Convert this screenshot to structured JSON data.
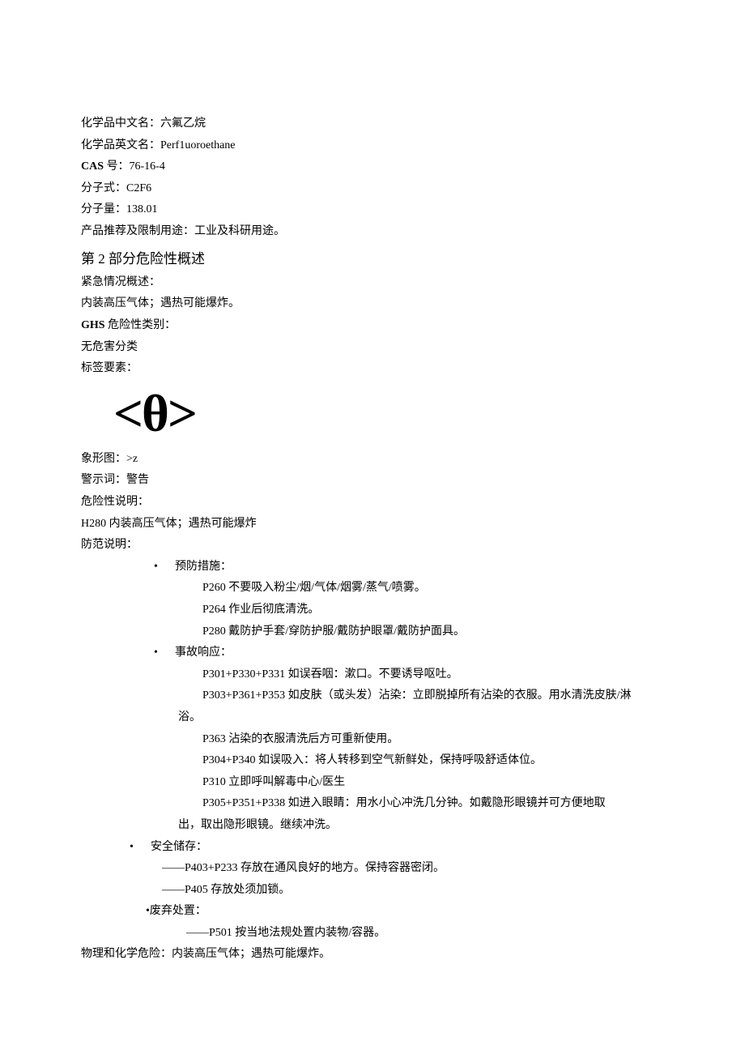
{
  "header": {
    "cn_name_label": "化学品中文名：",
    "cn_name_value": "六氟乙烷",
    "en_name_label": "化学品英文名：",
    "en_name_value": "Perf1uoroethane",
    "cas_label": "CAS",
    "cas_suffix": " 号：",
    "cas_value": "76-16-4",
    "formula_label": "分子式：",
    "formula_value": "C2F6",
    "mw_label": "分子量：",
    "mw_value": "138.01",
    "use_label": "产品推荐及限制用途：",
    "use_value": "工业及科研用途。"
  },
  "section2": {
    "title": "第 2 部分危险性概述",
    "emergency_label": "紧急情况概述：",
    "emergency_text": "内装高压气体；遇热可能爆炸。",
    "ghs_label": "GHS",
    "ghs_suffix": " 危险性类别：",
    "ghs_text": "无危害分类",
    "label_elements": "标签要素：",
    "pictogram_symbol": "<θ>",
    "pictogram_label": "象形图：",
    "pictogram_value": ">z",
    "signal_label": "警示词：",
    "signal_value": "警告",
    "hazard_label": "危险性说明：",
    "hazard_text": "H280 内装高压气体；遇热可能爆炸",
    "precaution_label": "防范说明：",
    "prevention": {
      "title": "预防措施：",
      "p260": "P260  不要吸入粉尘/烟/气体/烟雾/蒸气/喷雾。",
      "p264": "P264  作业后彻底清洗。",
      "p280": "P280  戴防护手套/穿防护服/戴防护眼罩/戴防护面具。"
    },
    "response": {
      "title": "事故响应：",
      "p301": "P301+P330+P331 如误吞咽：漱口。不要诱导呕吐。",
      "p303": "P303+P361+P353 如皮肤（或头发）沾染：立即脱掉所有沾染的衣服。用水清洗皮肤/淋",
      "p303b": "浴。",
      "p363": "P363 沾染的衣服清洗后方可重新使用。",
      "p304": "P304+P340 如误吸入：将人转移到空气新鲜处，保持呼吸舒适体位。",
      "p310": "P310 立即呼叫解毒中心/医生",
      "p305": "P305+P351+P338 如进入眼睛：用水小心冲洗几分钟。如戴隐形眼镜并可方便地取",
      "p305b": "出，取出隐形眼镜。继续冲洗。"
    },
    "storage": {
      "title": "安全储存：",
      "s1": "——P403+P233 存放在通风良好的地方。保持容器密闭。",
      "s2": "——P405 存放处须加锁。"
    },
    "disposal": {
      "title": "废弃处置：",
      "d1": "——P501 按当地法规处置内装物/容器。"
    },
    "physchem_label": "物理和化学危险：",
    "physchem_value": "内装高压气体；遇热可能爆炸。"
  }
}
